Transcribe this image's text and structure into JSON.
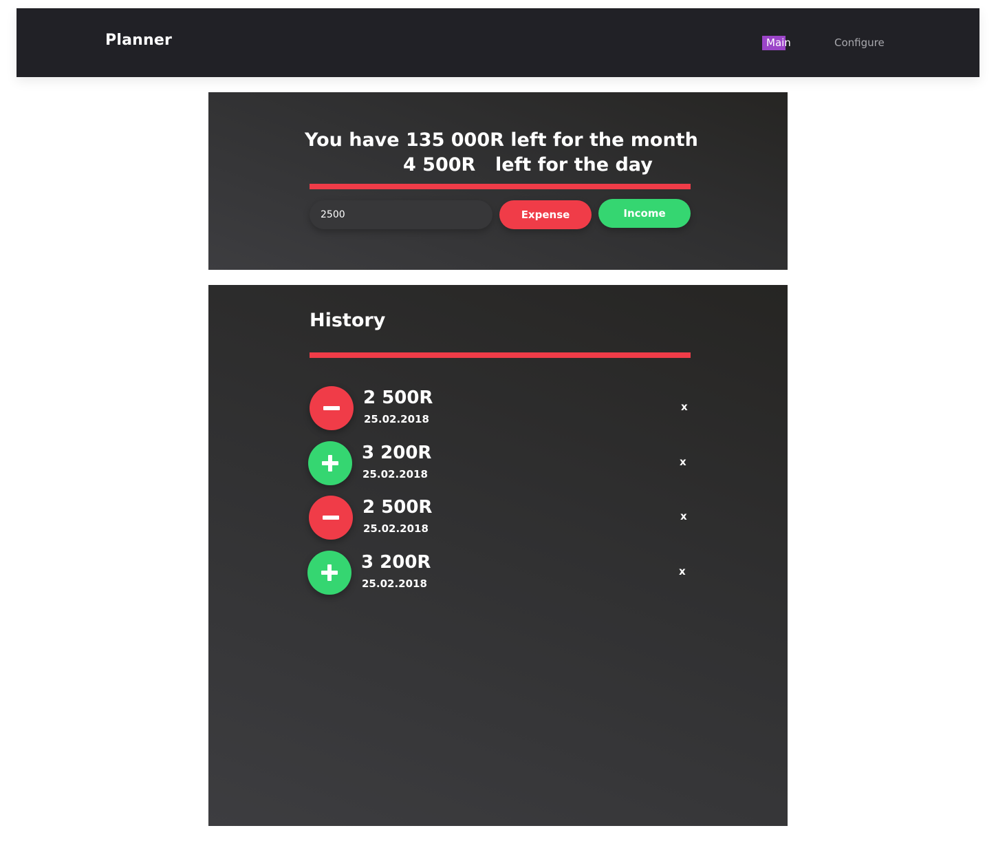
{
  "nav": {
    "brand": "Planner",
    "links": [
      {
        "label": "Main",
        "active": true
      },
      {
        "label": "Configure",
        "active": false
      }
    ]
  },
  "summary": {
    "month_text": "You have 135 000R left for the month",
    "day_amount": "4 500R",
    "day_label": "left for the day"
  },
  "entry": {
    "input_value": "2500",
    "expense_label": "Expense",
    "income_label": "Income"
  },
  "history": {
    "title": "History",
    "items": [
      {
        "type": "expense",
        "amount": "2 500R",
        "date": "25.02.2018",
        "remove": "x"
      },
      {
        "type": "income",
        "amount": "3 200R",
        "date": "25.02.2018",
        "remove": "x"
      },
      {
        "type": "expense",
        "amount": "2 500R",
        "date": "25.02.2018",
        "remove": "x"
      },
      {
        "type": "income",
        "amount": "3 200R",
        "date": "25.02.2018",
        "remove": "x"
      }
    ]
  },
  "colors": {
    "navbar": "#212126",
    "accent_red": "#f03c48",
    "accent_green": "#35d671",
    "active_highlight": "#9b45c8"
  },
  "icons": {
    "expense": "minus-icon",
    "income": "plus-icon"
  }
}
